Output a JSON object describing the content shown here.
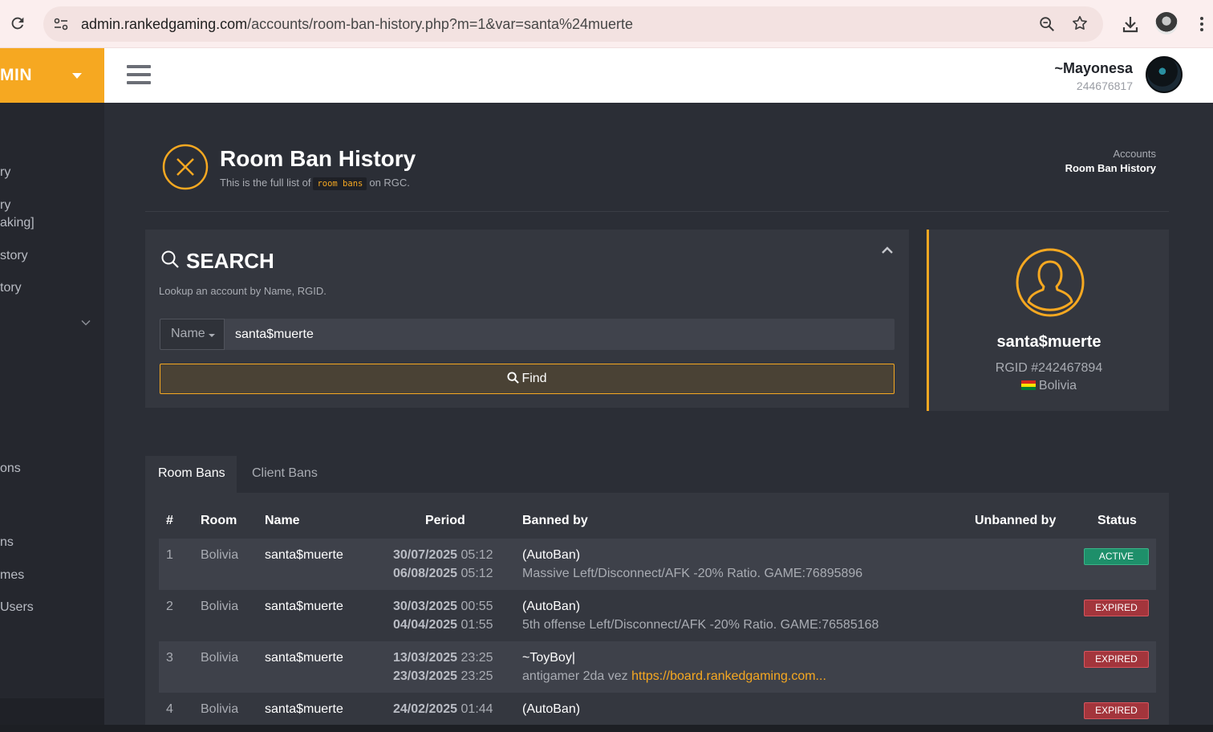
{
  "browser": {
    "url_host": "admin.rankedgaming.com",
    "url_path": "/accounts/room-ban-history.php?m=1&var=santa%24muerte"
  },
  "brand": {
    "label": "MIN"
  },
  "sidebar": {
    "items": [
      "ry",
      "ry",
      "aking]",
      "story",
      "tory",
      "ons",
      "ns",
      "mes",
      "Users"
    ]
  },
  "header": {
    "user_name": "~Mayonesa",
    "user_id": "244676817"
  },
  "page": {
    "title": "Room Ban History",
    "subtitle_pre": "This is the full list of",
    "subtitle_code": "room bans",
    "subtitle_post": "on RGC.",
    "breadcrumb_parent": "Accounts",
    "breadcrumb_current": "Room Ban History"
  },
  "search": {
    "title": "SEARCH",
    "description": "Lookup an account by Name, RGID.",
    "type_label": "Name",
    "value": "santa$muerte",
    "find_label": "Find"
  },
  "profile": {
    "name": "santa$muerte",
    "rgid": "RGID #242467894",
    "country": "Bolivia"
  },
  "tabs": {
    "room_bans": "Room Bans",
    "client_bans": "Client Bans"
  },
  "table": {
    "headers": {
      "num": "#",
      "room": "Room",
      "name": "Name",
      "period": "Period",
      "banned_by": "Banned by",
      "unbanned_by": "Unbanned by",
      "status": "Status"
    },
    "rows": [
      {
        "num": "1",
        "room": "Bolivia",
        "name": "santa$muerte",
        "start_date": "30/07/2025",
        "start_time": "05:12",
        "end_date": "06/08/2025",
        "end_time": "05:12",
        "banned_by": "(AutoBan)",
        "reason": "Massive Left/Disconnect/AFK -20% Ratio. GAME:76895896",
        "link": "",
        "status": "ACTIVE"
      },
      {
        "num": "2",
        "room": "Bolivia",
        "name": "santa$muerte",
        "start_date": "30/03/2025",
        "start_time": "00:55",
        "end_date": "04/04/2025",
        "end_time": "01:55",
        "banned_by": "(AutoBan)",
        "reason": "5th offense Left/Disconnect/AFK -20% Ratio. GAME:76585168",
        "link": "",
        "status": "EXPIRED"
      },
      {
        "num": "3",
        "room": "Bolivia",
        "name": "santa$muerte",
        "start_date": "13/03/2025",
        "start_time": "23:25",
        "end_date": "23/03/2025",
        "end_time": "23:25",
        "banned_by": "~ToyBoy|",
        "reason": "antigamer 2da vez",
        "link": "https://board.rankedgaming.com...",
        "status": "EXPIRED"
      },
      {
        "num": "4",
        "room": "Bolivia",
        "name": "santa$muerte",
        "start_date": "24/02/2025",
        "start_time": "01:44",
        "end_date": "",
        "end_time": "",
        "banned_by": "(AutoBan)",
        "reason": "",
        "link": "",
        "status": "EXPIRED"
      }
    ]
  },
  "colors": {
    "accent": "#f6a821",
    "active_badge": "#1e8f6a",
    "expired_badge": "#a3353c",
    "background": "#2b2e36",
    "panel": "#34373f"
  }
}
